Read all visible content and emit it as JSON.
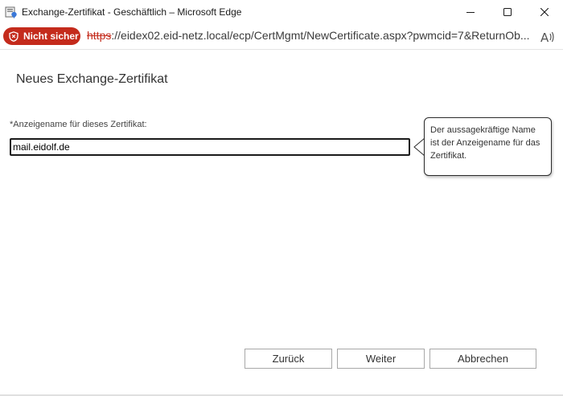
{
  "window": {
    "title": "Exchange-Zertifikat - Geschäftlich – Microsoft Edge"
  },
  "addressbar": {
    "security_label": "Nicht sicher",
    "url_scheme": "https",
    "url_rest": "://eidex02.eid-netz.local/ecp/CertMgmt/NewCertificate.aspx?pwmcid=7&ReturnOb..."
  },
  "page": {
    "title": "Neues Exchange-Zertifikat",
    "field_label": "*Anzeigename für dieses Zertifikat:",
    "field_value": "mail.eidolf.de",
    "help_text": "Der aussagekräftige Name ist der Anzeigename für das Zertifikat."
  },
  "buttons": {
    "back": "Zurück",
    "next": "Weiter",
    "cancel": "Abbrechen"
  },
  "colors": {
    "security_red": "#c42b1c",
    "selection_blue": "#0078d4"
  },
  "icons": {
    "app": "exchange-certificate-icon",
    "security": "shield-warning-icon",
    "read_aloud": "read-aloud-icon"
  }
}
